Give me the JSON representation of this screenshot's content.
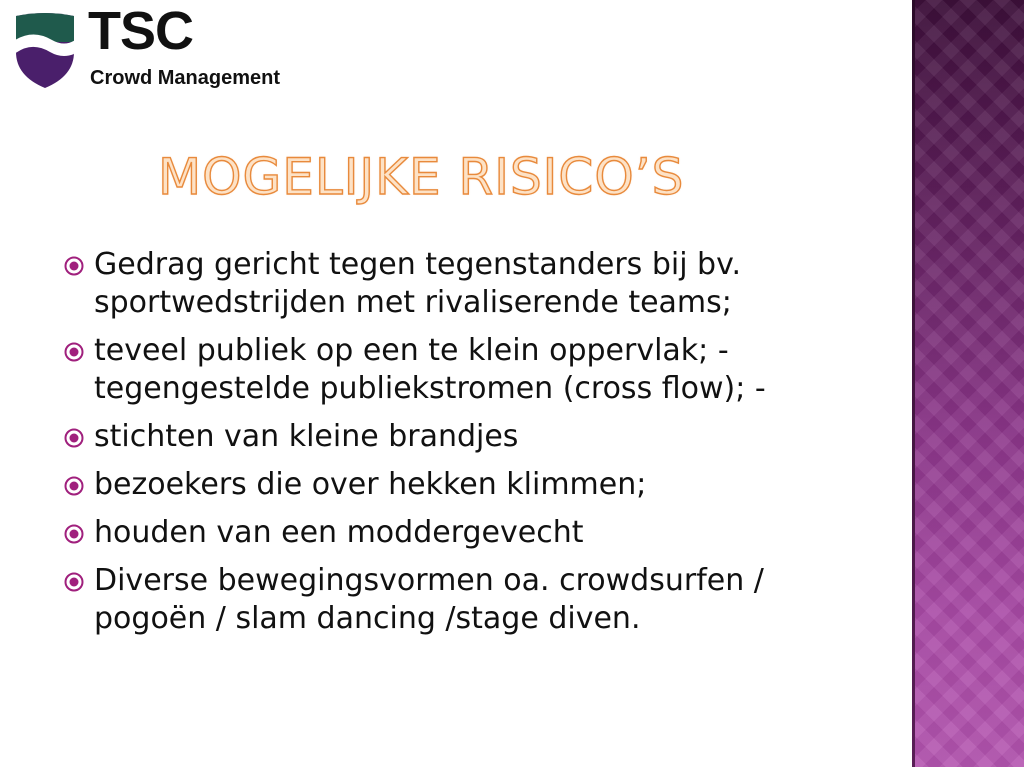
{
  "logo": {
    "name": "TSC",
    "subtitle": "Crowd Management",
    "colors": {
      "shield_top": "#1f5a4c",
      "shield_bottom": "#4a1f6b",
      "wave": "#ffffff"
    }
  },
  "title": "MOGELIJKE RISICO’S",
  "colors": {
    "title_fill": "#fde2c6",
    "title_outline": "#e88a3c",
    "bullet": "#a0207d",
    "side_panel": "#6e2a6c"
  },
  "bullets": [
    {
      "icon": "target-bullet-icon",
      "text": "Gedrag gericht tegen tegenstanders bij bv.\nsportwedstrijden met rivaliserende teams;"
    },
    {
      "icon": "target-bullet-icon",
      "text": "teveel publiek op een te klein oppervlak; -\ntegengestelde publiekstromen (cross flow); -"
    },
    {
      "icon": "target-bullet-icon",
      "text": "stichten van kleine brandjes"
    },
    {
      "icon": "target-bullet-icon",
      "text": "bezoekers die over hekken klimmen;"
    },
    {
      "icon": "target-bullet-icon",
      "text": "houden van een moddergevecht"
    },
    {
      "icon": "target-bullet-icon",
      "text": "Diverse bewegingsvormen  oa. crowdsurfen /\npogoën / slam dancing /stage diven."
    }
  ]
}
